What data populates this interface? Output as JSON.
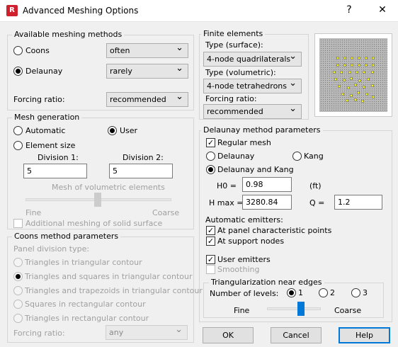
{
  "window": {
    "title": "Advanced Meshing Options",
    "help_glyph": "?",
    "close_glyph": "✕",
    "app_icon": "R"
  },
  "meshing_methods": {
    "title": "Available meshing methods",
    "coons_label": "Coons",
    "coons_value": "often",
    "delaunay_label": "Delaunay",
    "delaunay_value": "rarely",
    "forcing_label": "Forcing ratio:",
    "forcing_value": "recommended",
    "selected": "Delaunay"
  },
  "mesh_generation": {
    "title": "Mesh generation",
    "automatic_label": "Automatic",
    "user_label": "User",
    "element_size_label": "Element size",
    "division1_label": "Division 1:",
    "division1_value": "5",
    "division2_label": "Division 2:",
    "division2_value": "5",
    "volumetric_label": "Mesh of volumetric elements",
    "fine_label": "Fine",
    "coarse_label": "Coarse",
    "additional_label": "Additional meshing of solid surface",
    "selected": "User"
  },
  "coons_params": {
    "title": "Coons method parameters",
    "panel_division_label": "Panel division type:",
    "options": [
      "Triangles in triangular contour",
      "Triangles and squares in triangular contour",
      "Triangles and trapezoids in triangular contour",
      "Squares in rectangular contour",
      "Triangles in rectangular contour"
    ],
    "forcing_label": "Forcing ratio:",
    "forcing_value": "any"
  },
  "finite_elements": {
    "title": "Finite elements",
    "surface_label": "Type (surface):",
    "surface_value": "4-node quadrilaterals",
    "volumetric_label": "Type (volumetric):",
    "volumetric_value": "4-node tetrahedrons",
    "forcing_label": "Forcing ratio:",
    "forcing_value": "recommended"
  },
  "delaunay_params": {
    "title": "Delaunay method parameters",
    "regular_mesh_label": "Regular mesh",
    "delaunay_label": "Delaunay",
    "kang_label": "Kang",
    "delaunay_kang_label": "Delaunay and Kang",
    "selected": "Delaunay and Kang",
    "h0_label": "H0 =",
    "h0_value": "0.98",
    "unit": "(ft)",
    "hmax_label": "H max =",
    "hmax_value": "3280.84",
    "q_label": "Q =",
    "q_value": "1.2",
    "auto_emitters_label": "Automatic emitters:",
    "panel_points_label": "At panel characteristic points",
    "support_nodes_label": "At support nodes",
    "user_emitters_label": "User emitters",
    "smoothing_label": "Smoothing",
    "check_glyph": "✓"
  },
  "triangularization": {
    "title": "Triangularization near edges",
    "levels_label": "Number of levels:",
    "level_options": [
      "1",
      "2",
      "3"
    ],
    "selected": "1",
    "fine_label": "Fine",
    "coarse_label": "Coarse",
    "slider_fraction": 0.65
  },
  "buttons": {
    "ok": "OK",
    "cancel": "Cancel",
    "help": "Help"
  },
  "colors": {
    "accent": "#0078d7",
    "dot": "#ffff00"
  }
}
